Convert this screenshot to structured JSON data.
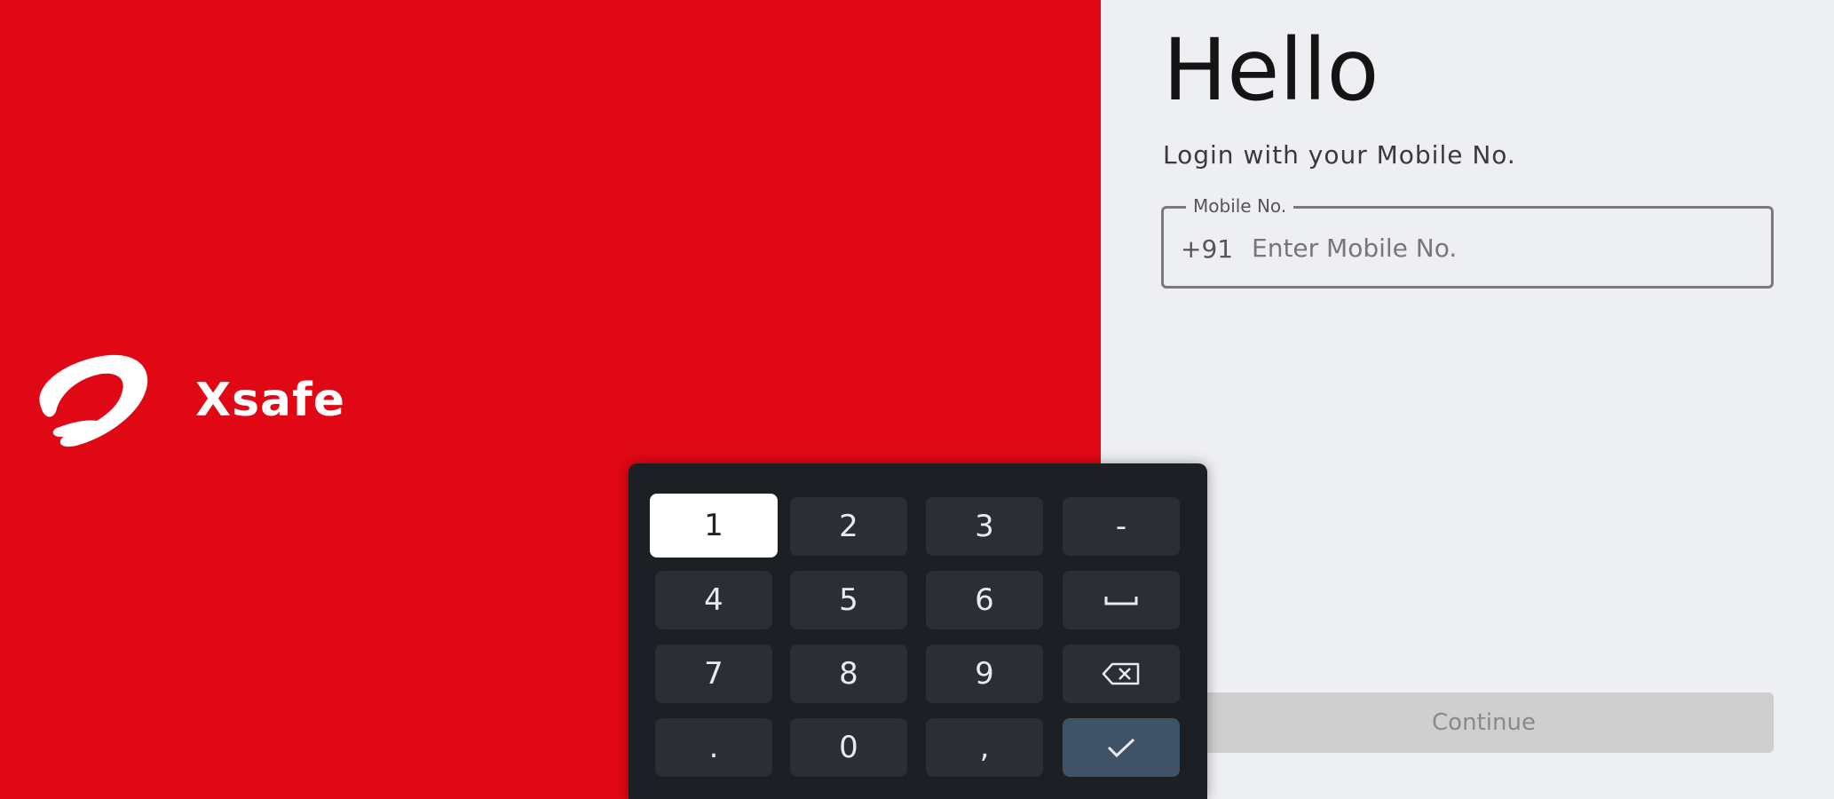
{
  "brand": {
    "name": "Xsafe",
    "logo_icon": "airtel-swirl-logo",
    "color": "#e00814"
  },
  "login": {
    "title": "Hello",
    "subtitle": "Login with your Mobile No.",
    "mobile_field": {
      "legend": "Mobile No.",
      "prefix": "+91",
      "placeholder": "Enter Mobile No.",
      "value": ""
    },
    "continue_label": "Continue"
  },
  "keypad": {
    "rows": [
      [
        "1",
        "2",
        "3",
        "-"
      ],
      [
        "4",
        "5",
        "6",
        "space-icon"
      ],
      [
        "7",
        "8",
        "9",
        "backspace-icon"
      ],
      [
        ".",
        "0",
        ",",
        "checkmark-icon"
      ]
    ],
    "labels": {
      "k1": "1",
      "k2": "2",
      "k3": "3",
      "dash": "-",
      "k4": "4",
      "k5": "5",
      "k6": "6",
      "k7": "7",
      "k8": "8",
      "k9": "9",
      "dot": ".",
      "k0": "0",
      "comma": ","
    },
    "focused_key": "1",
    "confirm_color": "#3f5266"
  }
}
